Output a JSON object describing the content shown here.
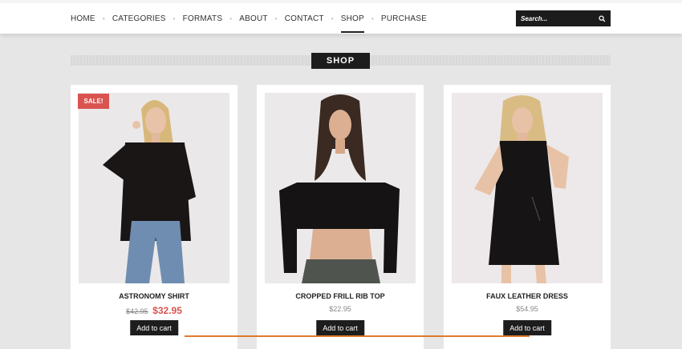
{
  "nav": {
    "items": [
      {
        "label": "HOME",
        "active": false
      },
      {
        "label": "CATEGORIES",
        "active": false
      },
      {
        "label": "FORMATS",
        "active": false
      },
      {
        "label": "ABOUT",
        "active": false
      },
      {
        "label": "CONTACT",
        "active": false
      },
      {
        "label": "SHOP",
        "active": true
      },
      {
        "label": "PURCHASE",
        "active": false
      }
    ]
  },
  "search": {
    "placeholder": "Search...",
    "icon": "search-icon"
  },
  "section": {
    "title": "SHOP"
  },
  "products": [
    {
      "name": "ASTRONOMY SHIRT",
      "old_price": "$42.95",
      "price": "$32.95",
      "badge": "SALE!",
      "button": "Add to cart"
    },
    {
      "name": "CROPPED FRILL RIB TOP",
      "price": "$22.95",
      "button": "Add to cart"
    },
    {
      "name": "FAUX LEATHER DRESS",
      "price": "$54.95",
      "button": "Add to cart"
    }
  ],
  "colors": {
    "accent_sale": "#d9534f",
    "dark": "#1d1d1d",
    "bottom_accent": "#e07a2e"
  }
}
